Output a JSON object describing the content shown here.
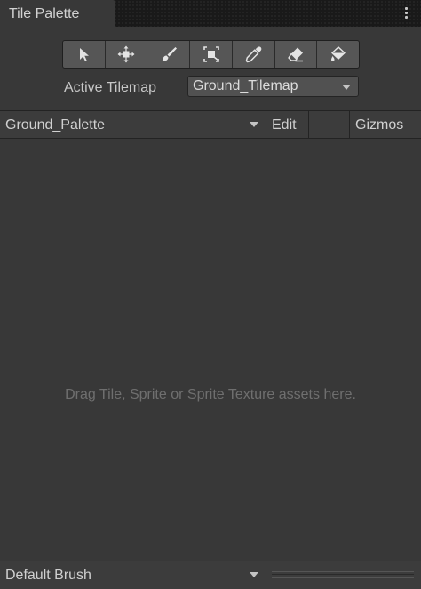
{
  "window": {
    "tab_title": "Tile Palette",
    "menu_icon": "kebab-menu-icon"
  },
  "toolbar": {
    "tools": [
      {
        "name": "select",
        "icon": "select-arrow-icon"
      },
      {
        "name": "move",
        "icon": "move-icon"
      },
      {
        "name": "paint",
        "icon": "paintbrush-icon"
      },
      {
        "name": "box-fill",
        "icon": "box-fill-icon"
      },
      {
        "name": "pick",
        "icon": "eyedropper-icon"
      },
      {
        "name": "erase",
        "icon": "eraser-icon"
      },
      {
        "name": "fill",
        "icon": "paint-bucket-icon"
      }
    ]
  },
  "active_tilemap": {
    "label": "Active Tilemap",
    "value": "Ground_Tilemap"
  },
  "palette_bar": {
    "palette": "Ground_Palette",
    "edit_label": "Edit",
    "gizmos_label": "Gizmos"
  },
  "drop_area": {
    "hint": "Drag Tile, Sprite or Sprite Texture assets here."
  },
  "bottom_bar": {
    "brush": "Default Brush"
  },
  "colors": {
    "background": "#383838",
    "titlebar": "#191919",
    "toolbar_button": "#565656",
    "dropdown": "#515151",
    "text": "#c4c4c4",
    "hint_text": "#6f6f6f"
  }
}
